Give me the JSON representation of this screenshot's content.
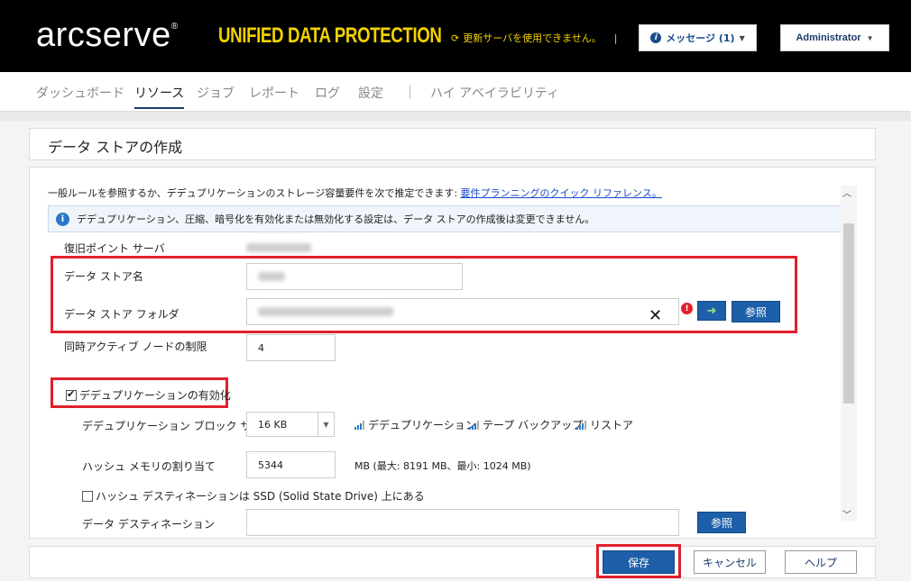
{
  "header": {
    "brand": "arcserve",
    "brand_mark": "®",
    "product": "UNIFIED DATA PROTECTION",
    "update_warning": "更新サーバを使用できません。",
    "messages_label": "メッセージ (1)",
    "user_label": "Administrator"
  },
  "nav": {
    "items": [
      {
        "label": "ダッシュボード"
      },
      {
        "label": "リソース"
      },
      {
        "label": "ジョブ"
      },
      {
        "label": "レポート"
      },
      {
        "label": "ログ"
      },
      {
        "label": "設定"
      },
      {
        "label": "ハイ アベイラビリティ"
      }
    ],
    "active": "リソース"
  },
  "page": {
    "title": "データ ストアの作成"
  },
  "form": {
    "intro_text": "一般ルールを参照するか、デデュプリケーションのストレージ容量要件を次で推定できます: ",
    "intro_link": "要件プランニングのクイック リファレンス。",
    "info_text": "デデュプリケーション、圧縮、暗号化を有効化または無効化する設定は、データ ストアの作成後は変更できません。",
    "recovery_server_label": "復旧ポイント サーバ",
    "datastore_name_label": "データ ストア名",
    "datastore_folder_label": "データ ストア フォルダ",
    "browse_label": "参照",
    "concurrent_label": "同時アクティブ ノードの制限",
    "concurrent_value": "4",
    "dedup_enable_label": "デデュプリケーションの有効化",
    "block_size_label": "デデュプリケーション ブロック サイズ",
    "block_size_value": "16 KB",
    "legend": [
      "デデュプリケーション",
      "テープ バックアップ",
      "リストア"
    ],
    "hash_memory_label": "ハッシュ メモリの割り当て",
    "hash_memory_value": "5344",
    "hash_memory_hint": "MB (最大: 8191 MB、最小: 1024 MB)",
    "ssd_label": "ハッシュ デスティネーションは SSD (Solid State Drive) 上にある",
    "dest_label": "データ デスティネーション",
    "browse2_label": "参照"
  },
  "footer": {
    "save_label": "保存",
    "cancel_label": "キャンセル",
    "help_label": "ヘルプ"
  },
  "colors": {
    "brand_bar": "#000000",
    "product_yellow": "#f2d200",
    "primary_button": "#1d5fa8",
    "highlight_red": "#e0202c"
  }
}
